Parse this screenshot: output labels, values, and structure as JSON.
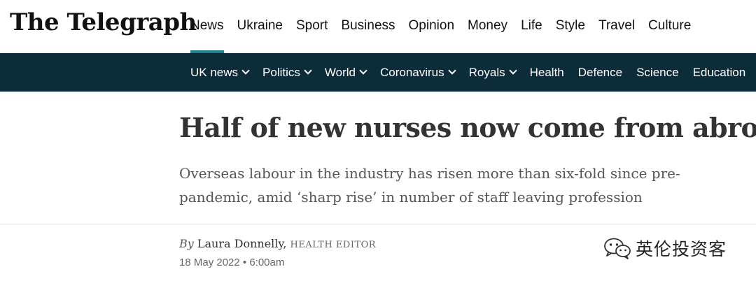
{
  "header": {
    "logo_text": "The Telegraph",
    "nav": [
      {
        "label": "News",
        "active": true
      },
      {
        "label": "Ukraine"
      },
      {
        "label": "Sport"
      },
      {
        "label": "Business"
      },
      {
        "label": "Opinion"
      },
      {
        "label": "Money"
      },
      {
        "label": "Life"
      },
      {
        "label": "Style"
      },
      {
        "label": "Travel"
      },
      {
        "label": "Culture"
      }
    ]
  },
  "subnav": {
    "items": [
      {
        "label": "UK news",
        "dropdown": true
      },
      {
        "label": "Politics",
        "dropdown": true
      },
      {
        "label": "World",
        "dropdown": true
      },
      {
        "label": "Coronavirus",
        "dropdown": true
      },
      {
        "label": "Royals",
        "dropdown": true
      },
      {
        "label": "Health"
      },
      {
        "label": "Defence"
      },
      {
        "label": "Science"
      },
      {
        "label": "Education"
      }
    ]
  },
  "article": {
    "headline": "Half of new nurses now come from abroad",
    "standfirst": "Overseas labour in the industry has risen more than six-fold since pre-pandemic, amid ‘sharp rise’ in number of staff leaving profession",
    "byline": {
      "by": "By",
      "author": "Laura Donnelly,",
      "role": "HEALTH EDITOR"
    },
    "date": "18 May 2022 • 6:00am"
  },
  "watermark": {
    "text": "英伦投资客",
    "icon": "wechat-icon"
  },
  "colors": {
    "subnav_bg": "#0c2c3a",
    "active_underline": "#1f7f8a"
  }
}
